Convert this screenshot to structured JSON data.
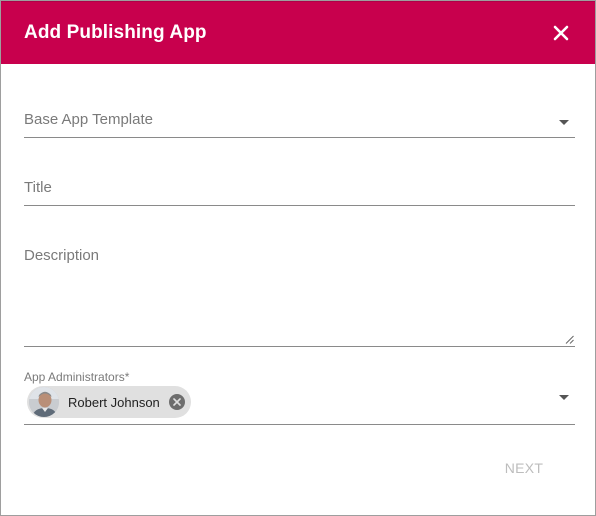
{
  "colors": {
    "header_bg": "#c8004d",
    "header_text": "#ffffff",
    "disabled_text": "#bdbdbd"
  },
  "dialog": {
    "title": "Add Publishing App",
    "close_icon": "close-icon"
  },
  "form": {
    "base_template": {
      "label": "Base App Template",
      "value": ""
    },
    "title": {
      "label": "Title",
      "value": ""
    },
    "description": {
      "label": "Description",
      "value": ""
    },
    "administrators": {
      "label": "App Administrators*",
      "selected": [
        {
          "name": "Robert Johnson",
          "avatar_icon": "person-avatar"
        }
      ]
    }
  },
  "actions": {
    "next_label": "NEXT",
    "next_enabled": false
  }
}
